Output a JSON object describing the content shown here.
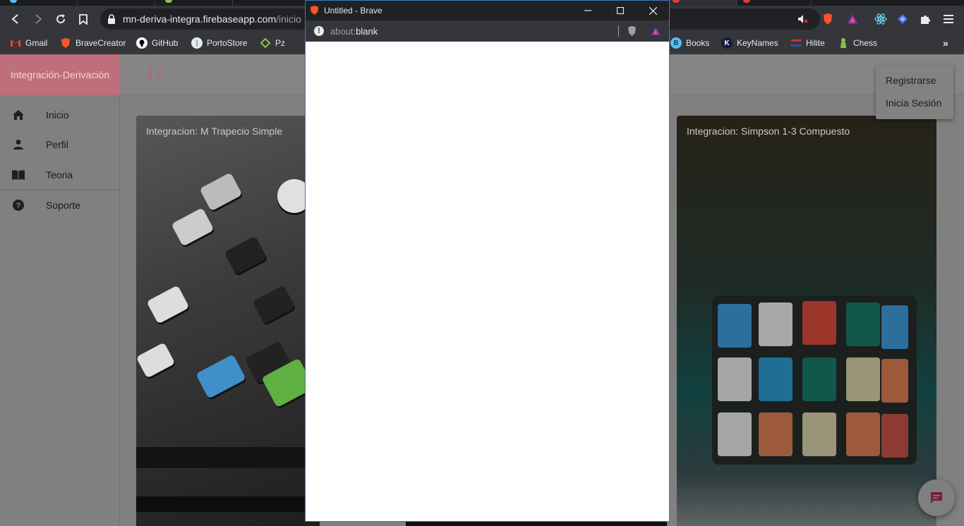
{
  "browser": {
    "url_host": "mn-deriva-integra.firebaseapp.com",
    "url_path": "/inicio",
    "bookmarks": [
      {
        "label": "Gmail",
        "icon": "gmail-icon",
        "color": "#ea4335"
      },
      {
        "label": "BraveCreator",
        "icon": "brave-icon",
        "color": "#fb542b"
      },
      {
        "label": "GitHub",
        "icon": "github-icon",
        "color": "#ffffff"
      },
      {
        "label": "PortoStore",
        "icon": "portostore-icon",
        "color": "#4f8fd6"
      },
      {
        "label": "Pz",
        "icon": "pz-icon",
        "color": "#8bc34a"
      },
      {
        "label": "Books",
        "icon": "books-icon",
        "color": "#4fc3f7"
      },
      {
        "label": "KeyNames",
        "icon": "keynames-icon",
        "color": "#3f51b5"
      },
      {
        "label": "Hilite",
        "icon": "hilite-icon",
        "color": "#d32f2f"
      },
      {
        "label": "Chess",
        "icon": "chess-icon",
        "color": "#8bc34a"
      }
    ]
  },
  "app": {
    "brand": "Integración-Derivación",
    "nav": [
      {
        "label": "Inicio",
        "icon": "home-icon"
      },
      {
        "label": "Perfil",
        "icon": "person-icon"
      },
      {
        "label": "Teoria",
        "icon": "book-icon"
      },
      {
        "label": "Soporte",
        "icon": "help-icon"
      }
    ],
    "cards": [
      {
        "title": "Integracion: M Trapecio Simple"
      },
      {
        "title": "Integracion: Simpson 1-3 Compuesto"
      }
    ],
    "menu": {
      "register": "Registrarse",
      "login": "Inicia Sesión"
    },
    "accent": "#c06070"
  },
  "popup": {
    "title": "Untitled - Brave",
    "url_scheme": "about:",
    "url_host": "blank"
  }
}
